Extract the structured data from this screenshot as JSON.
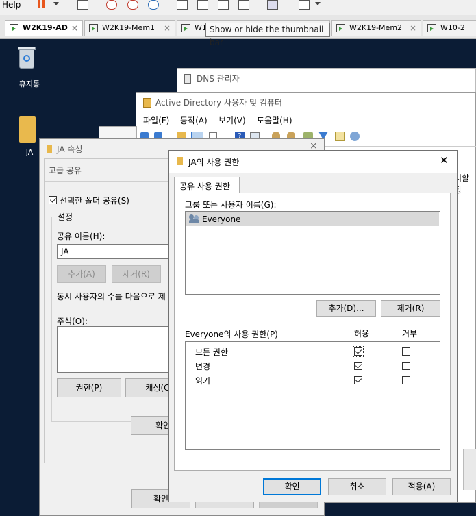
{
  "toolbar": {
    "help_label": "Help"
  },
  "tabs": [
    {
      "label": "W2K19-AD",
      "close": "×"
    },
    {
      "label": "W2K19-Mem1",
      "close": "×"
    },
    {
      "label": "W1",
      "close": ""
    },
    {
      "label": "W2K19-Mem2",
      "close": "×"
    },
    {
      "label": "W10-2",
      "close": ""
    }
  ],
  "tooltip": "Show or hide the thumbnail bar",
  "desktop": {
    "recycle_bin": "휴지통",
    "folder": "JA"
  },
  "dns_window": {
    "title": "DNS 관리자"
  },
  "ad_window": {
    "title": "Active Directory 사용자 및 컴퓨터",
    "menu": [
      "파일(F)",
      "동작(A)",
      "보기(V)",
      "도움말(H)"
    ],
    "partial_behind": "서버",
    "partial_right": "시할 항"
  },
  "props_window": {
    "title": "JA 속성",
    "close": "×",
    "tab": "고급 공유",
    "share_checkbox": "선택한 폴더 공유(S)",
    "settings_group": "설정",
    "share_name_label": "공유 이름(H):",
    "share_name_value": "JA",
    "add_button": "추가(A)",
    "remove_button": "제거(R)",
    "user_limit_text": "동시 사용자의 수를 다음으로 제",
    "comment_label": "주석(O):",
    "permissions_button": "권한(P)",
    "cache_button": "캐싱(C",
    "ok_button": "확인",
    "ok_bottom": "확인"
  },
  "perm_dialog": {
    "title": "JA의 사용 권한",
    "close": "✕",
    "tab": "공유 사용 권한",
    "group_label": "그룹 또는 사용자 이름(G):",
    "users": [
      "Everyone"
    ],
    "add_button": "추가(D)...",
    "remove_button": "제거(R)",
    "perm_header": "Everyone의 사용 권한(P)",
    "allow_header": "허용",
    "deny_header": "거부",
    "permissions": [
      {
        "name": "모든 권한",
        "allow": true,
        "deny": false
      },
      {
        "name": "변경",
        "allow": true,
        "deny": false
      },
      {
        "name": "읽기",
        "allow": true,
        "deny": false
      }
    ],
    "ok_button": "확인",
    "cancel_button": "취소",
    "apply_button": "적용(A)"
  }
}
